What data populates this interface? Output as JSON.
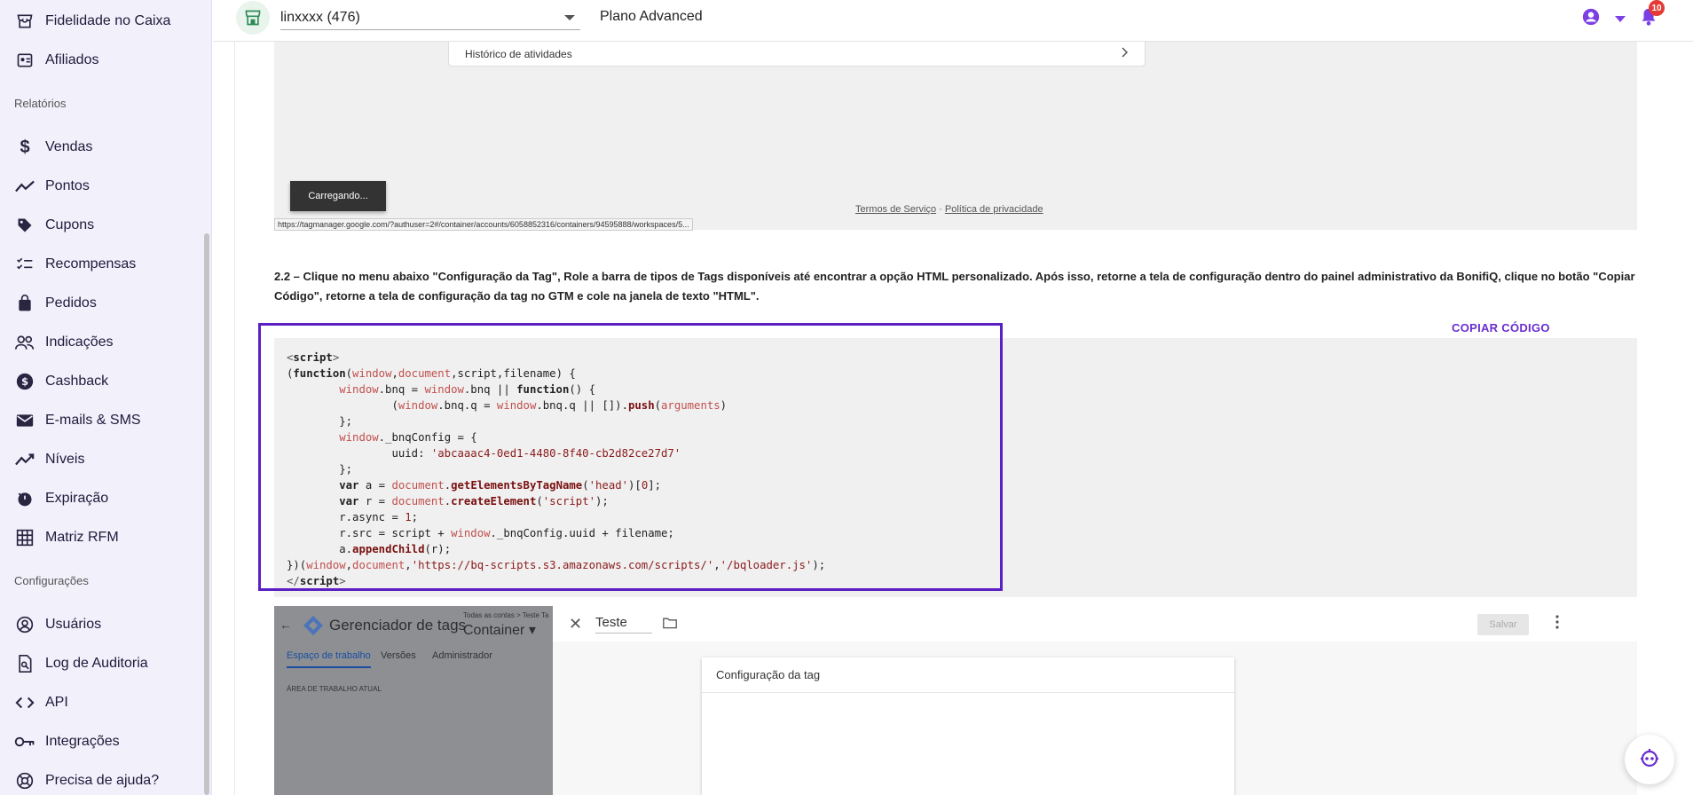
{
  "sidebar": {
    "items_top": [
      {
        "label": "Fidelidade no Caixa",
        "icon": "store-icon"
      },
      {
        "label": "Afiliados",
        "icon": "affiliate-icon"
      }
    ],
    "section_reports": "Relatórios",
    "items_reports": [
      {
        "label": "Vendas",
        "icon": "dollar-icon"
      },
      {
        "label": "Pontos",
        "icon": "trend-icon"
      },
      {
        "label": "Cupons",
        "icon": "tag-icon"
      },
      {
        "label": "Recompensas",
        "icon": "checklist-icon"
      },
      {
        "label": "Pedidos",
        "icon": "bag-icon"
      },
      {
        "label": "Indicações",
        "icon": "people-icon"
      },
      {
        "label": "Cashback",
        "icon": "coin-icon"
      },
      {
        "label": "E-mails & SMS",
        "icon": "mail-icon"
      },
      {
        "label": "Níveis",
        "icon": "trend-up-icon"
      },
      {
        "label": "Expiração",
        "icon": "timer-icon"
      },
      {
        "label": "Matriz RFM",
        "icon": "grid-icon"
      }
    ],
    "section_config": "Configurações",
    "items_config": [
      {
        "label": "Usuários",
        "icon": "user-circle-icon"
      },
      {
        "label": "Log de Auditoria",
        "icon": "audit-log-icon"
      },
      {
        "label": "API",
        "icon": "code-icon"
      },
      {
        "label": "Integrações",
        "icon": "key-icon"
      },
      {
        "label": "Precisa de ajuda?",
        "icon": "help-icon"
      }
    ]
  },
  "topbar": {
    "store": "linxxxx (476)",
    "plan": "Plano Advanced",
    "notification_count": "10"
  },
  "shot_top": {
    "history": "Histórico de atividades",
    "loading": "Carregando...",
    "terms": "Termos de Serviço",
    "dot": "·",
    "privacy": "Política de privacidade",
    "url": "https://tagmanager.google.com/?authuser=2#/container/accounts/6058852316/containers/94595888/workspaces/5..."
  },
  "step": {
    "text": "2.2 – Clique no menu abaixo \"Configuração da Tag\", Role a barra de tipos de Tags disponíveis até encontrar a opção HTML personalizado. Após isso, retorne a tela de configuração dentro do painel administrativo da BonifiQ, clique no botão \"Copiar Código\", retorne a tela de configuração da tag no GTM e cole na janela de texto \"HTML\".",
    "copy_button": "COPIAR CÓDIGO"
  },
  "code": {
    "uuid": "'abcaaac4-0ed1-4480-8f40-cb2d82ce27d7'",
    "cdn": "'https://bq-scripts.s3.amazonaws.com/scripts/'",
    "loader": "'/bqloader.js'"
  },
  "gtm": {
    "title": "Gerenciador de tags",
    "crumb": "Todas as contas > Teste Ta",
    "container": "Container",
    "tabs": [
      "Espaço de trabalho",
      "Versões",
      "Administrador"
    ],
    "area": "ÁREA DE TRABALHO ATUAL",
    "tag_name": "Teste",
    "save": "Salvar",
    "config": "Configuração da tag"
  }
}
